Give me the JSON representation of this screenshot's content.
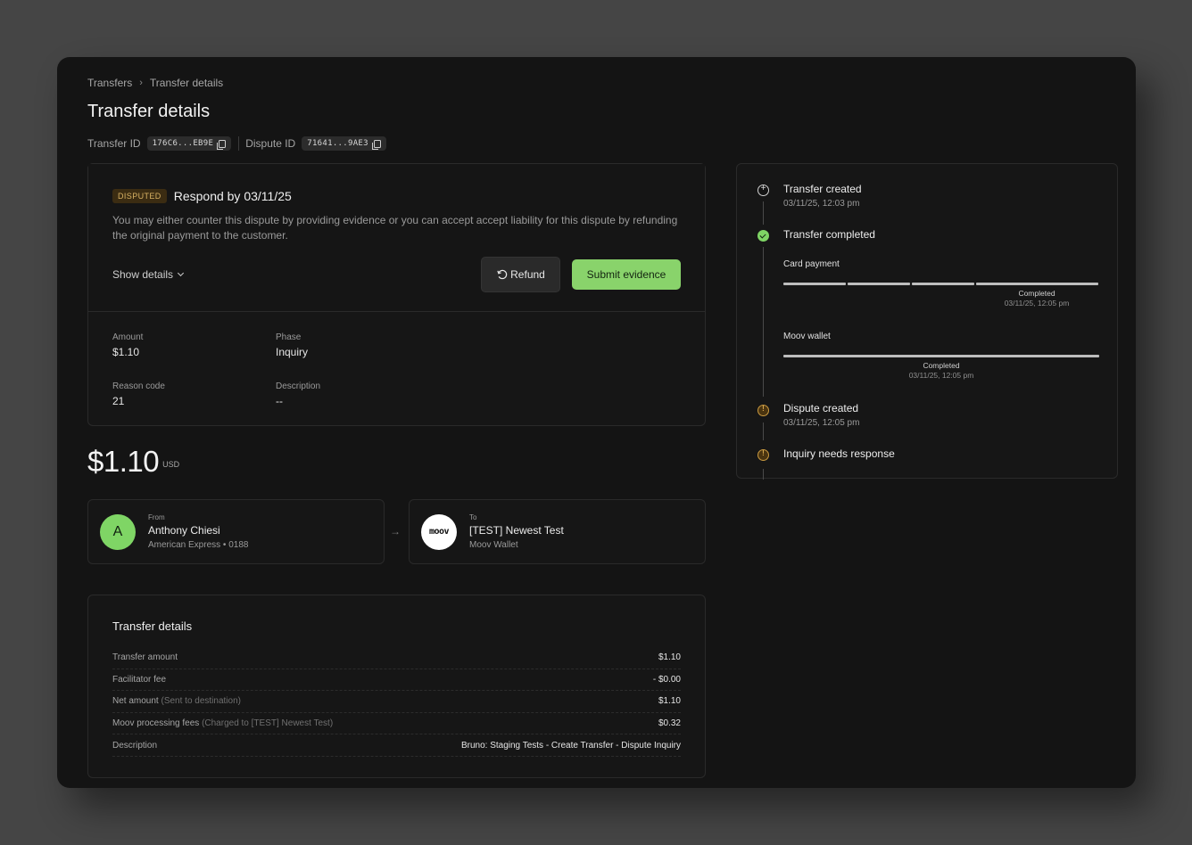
{
  "breadcrumb": {
    "root": "Transfers",
    "sep": "›",
    "current": "Transfer details"
  },
  "page": {
    "title": "Transfer details"
  },
  "ids": {
    "transfer_label": "Transfer ID",
    "transfer_value": "176C6...EB9E",
    "dispute_label": "Dispute ID",
    "dispute_value": "71641...9AE3"
  },
  "dispute": {
    "badge": "DISPUTED",
    "respond_by": "Respond by 03/11/25",
    "text": "You may either counter this dispute by providing evidence or you can accept accept liability for this dispute by refunding the original payment to the customer.",
    "show_details": "Show details",
    "refund_label": "Refund",
    "submit_label": "Submit evidence",
    "meta": {
      "amount_label": "Amount",
      "amount_value": "$1.10",
      "phase_label": "Phase",
      "phase_value": "Inquiry",
      "reason_label": "Reason code",
      "reason_value": "21",
      "description_label": "Description",
      "description_value": "--"
    }
  },
  "amount": {
    "value": "$1.10",
    "currency": "USD"
  },
  "from": {
    "kicker": "From",
    "initial": "A",
    "name": "Anthony Chiesi",
    "sub": "American Express • 0188"
  },
  "to": {
    "kicker": "To",
    "logo": "moov",
    "name": "[TEST] Newest Test",
    "sub": "Moov Wallet"
  },
  "arrow": "→",
  "details": {
    "title": "Transfer details",
    "rows": [
      {
        "label": "Transfer amount",
        "muted": "",
        "value": "$1.10"
      },
      {
        "label": "Facilitator fee",
        "muted": "",
        "value": "- $0.00"
      },
      {
        "label": "Net amount",
        "muted": "(Sent to destination)",
        "value": "$1.10"
      },
      {
        "label": "Moov processing fees",
        "muted": "(Charged to [TEST] Newest Test)",
        "value": "$0.32"
      },
      {
        "label": "Description",
        "muted": "",
        "value": "Bruno: Staging Tests - Create Transfer - Dispute Inquiry"
      }
    ]
  },
  "timeline": {
    "created_title": "Transfer created",
    "created_time": "03/11/25, 12:03 pm",
    "completed_title": "Transfer completed",
    "card_label": "Card payment",
    "card_status": "Completed",
    "card_time": "03/11/25, 12:05 pm",
    "wallet_label": "Moov wallet",
    "wallet_status": "Completed",
    "wallet_time": "03/11/25, 12:05 pm",
    "dispute_title": "Dispute created",
    "dispute_time": "03/11/25, 12:05 pm",
    "inquiry_title": "Inquiry needs response"
  },
  "colors": {
    "accent": "#89d36b",
    "warning": "#c99940",
    "background": "#141414"
  }
}
